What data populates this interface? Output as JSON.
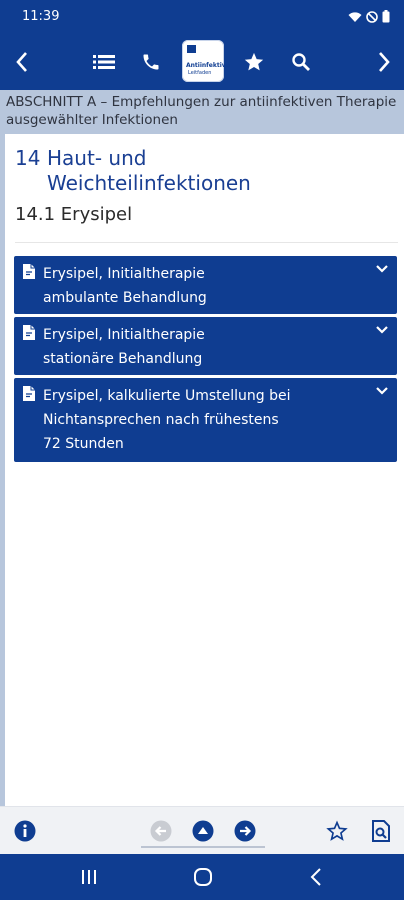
{
  "status": {
    "time": "11:39"
  },
  "app_bar": {
    "logo_line1": "Antiinfektiva",
    "logo_line2": "Leitfaden"
  },
  "section_header": "ABSCHNITT A – Empfehlungen zur antiinfektiven Therapie ausgewählter Infektionen",
  "chapter": {
    "number": "14",
    "title_line1": "Haut- und",
    "title_line2": "Weichteilinfektionen",
    "subsection": "14.1 Erysipel"
  },
  "accordion": [
    {
      "line1": "Erysipel, Initialtherapie",
      "line2": "ambulante Behandlung",
      "line3": ""
    },
    {
      "line1": "Erysipel, Initialtherapie",
      "line2": "stationäre Behandlung",
      "line3": ""
    },
    {
      "line1": "Erysipel, kalkulierte Umstellung bei",
      "line2": "Nichtansprechen nach frühestens",
      "line3": "72 Stunden"
    }
  ],
  "colors": {
    "primary": "#0f3d91",
    "section_bg": "#b7c6dc",
    "toolbar_bg": "#f0f2f5"
  },
  "icons": {
    "status": [
      "wifi-icon",
      "do-not-disturb-icon",
      "battery-icon"
    ],
    "app_bar": [
      "back-arrow-icon",
      "list-icon",
      "phone-icon",
      "star-icon",
      "search-icon",
      "forward-arrow-icon"
    ],
    "toolbar": [
      "info-icon",
      "previous-icon",
      "up-icon",
      "next-icon",
      "star-outline-icon",
      "search-document-icon"
    ],
    "nav": [
      "recents-icon",
      "home-icon",
      "back-icon"
    ]
  }
}
